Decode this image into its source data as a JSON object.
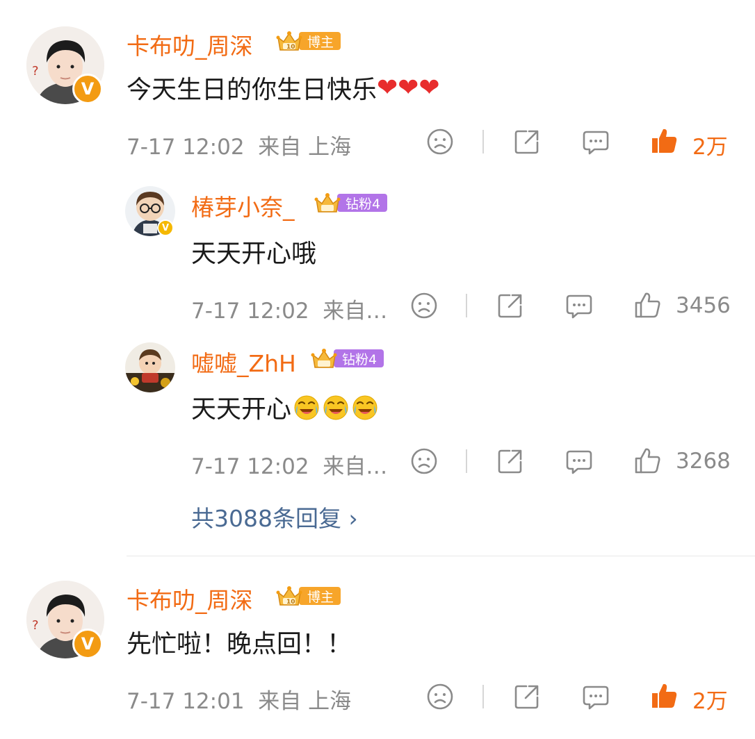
{
  "comments": [
    {
      "user": "卡布叻_周深",
      "badge": "博主",
      "text": "今天生日的你生日快乐",
      "emoji": "❤❤❤",
      "time": "7-17 12:02",
      "from": "来自 上海",
      "likes": "2万"
    },
    {
      "user": "卡布叻_周深",
      "badge": "博主",
      "text": "先忙啦！晚点回！！",
      "time": "7-17 12:01",
      "from": "来自 上海",
      "likes": "2万"
    }
  ],
  "replies": [
    {
      "user": "椿芽小奈_",
      "badge": "钻粉4",
      "text": "天天开心哦",
      "time": "7-17 12:02",
      "from": "来自…",
      "likes": "3456"
    },
    {
      "user": "嘘嘘_ZhH",
      "badge": "钻粉4",
      "text": "天天开心",
      "time": "7-17 12:02",
      "from": "来自…",
      "likes": "3268"
    }
  ],
  "more_replies": "共3088条回复",
  "chevron": "›",
  "verified_mark": "V",
  "crown_number": "10",
  "icons": {
    "dislike": "sad-face-icon",
    "share": "share-icon",
    "comment": "comment-icon",
    "like": "thumbs-up-icon"
  },
  "colors": {
    "username": "#f26b14",
    "liked": "#f26b14",
    "meta": "#8a8a8a",
    "link": "#4a6a93",
    "boss_badge": "#f7a52a",
    "fan_badge": "#b274e8"
  }
}
